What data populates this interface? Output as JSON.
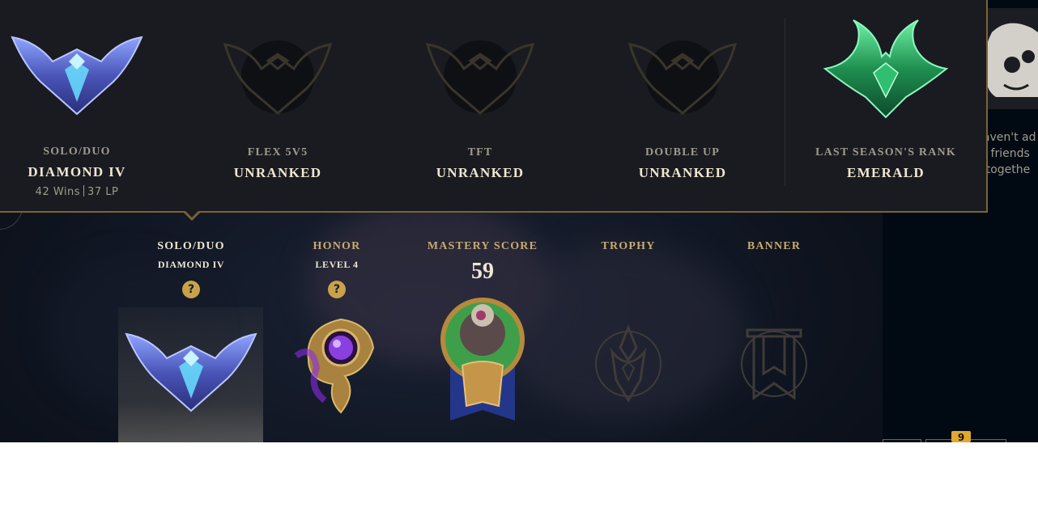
{
  "ranked_popup": {
    "queues": [
      {
        "queue": "SOLO/DUO",
        "tier": "DIAMOND IV",
        "wins": "42 Wins",
        "lp": "37 LP",
        "emblem": "diamond-emblem"
      },
      {
        "queue": "FLEX 5V5",
        "tier": "UNRANKED",
        "emblem": "unranked-emblem"
      },
      {
        "queue": "TFT",
        "tier": "UNRANKED",
        "emblem": "unranked-emblem"
      },
      {
        "queue": "DOUBLE UP",
        "tier": "UNRANKED",
        "emblem": "unranked-emblem"
      }
    ],
    "last_season": {
      "label": "LAST SEASON'S RANK",
      "tier": "EMERALD",
      "emblem": "emerald-emblem"
    }
  },
  "profile_bar": {
    "solo": {
      "title": "SOLO/DUO",
      "subtitle": "DIAMOND IV",
      "help": "?"
    },
    "honor": {
      "title": "HONOR",
      "subtitle": "LEVEL 4",
      "help": "?"
    },
    "mastery": {
      "title": "MASTERY SCORE",
      "score": "59"
    },
    "trophy": {
      "title": "TROPHY"
    },
    "banner": {
      "title": "BANNER"
    }
  },
  "right_panel": {
    "lines": [
      "haven't ad",
      "te friends",
      "y togethe"
    ]
  },
  "footer": {
    "badge_count": "9"
  },
  "colors": {
    "gold": "#c8aa6e",
    "gold_border": "#7b6434",
    "text_light": "#f0e6d2",
    "text_muted": "#a09b8c",
    "popup_bg": "#1a1b20",
    "diamond": "#5b6fd6",
    "emerald": "#2fbf71",
    "badge": "#e0a82e"
  }
}
